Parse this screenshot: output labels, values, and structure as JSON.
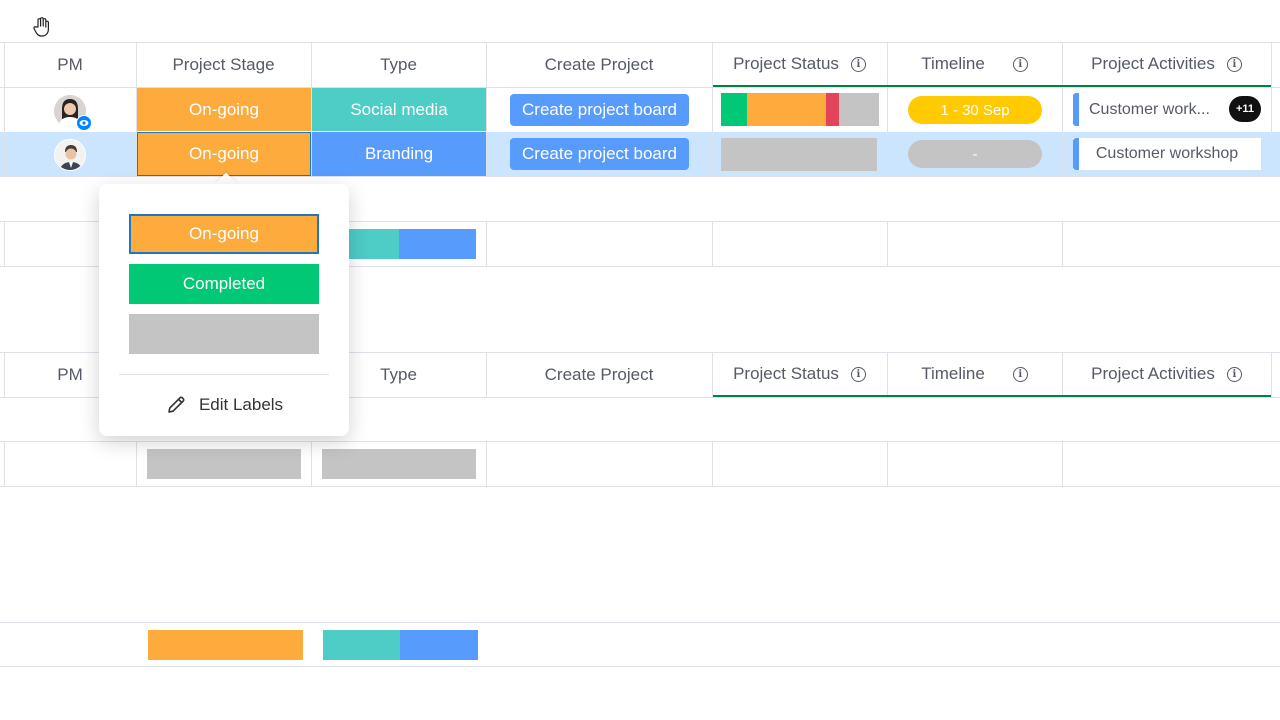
{
  "colors": {
    "on_going": "#fdab3d",
    "completed": "#00c875",
    "empty": "#c4c4c4",
    "social_media": "#4eccc6",
    "branding": "#579bfc",
    "stuck": "#e2445c",
    "timeline_yellow": "#ffcb00",
    "selected_row": "#cce5ff",
    "header_underline": "#037f4c"
  },
  "board1": {
    "headers": {
      "pm": "PM",
      "project_stage": "Project Stage",
      "type": "Type",
      "create_project": "Create Project",
      "project_status": "Project Status",
      "timeline": "Timeline",
      "project_activities": "Project Activities"
    },
    "rows": [
      {
        "stage": "On-going",
        "type": "Social media",
        "create_button": "Create project board",
        "status_bar": [
          {
            "label": "Completed",
            "fraction": 0.16
          },
          {
            "label": "On-going",
            "fraction": 0.5
          },
          {
            "label": "Stuck",
            "fraction": 0.08
          },
          {
            "label": "Empty",
            "fraction": 0.26
          }
        ],
        "timeline": "1 - 30 Sep",
        "activity": "Customer work...",
        "activity_count": "+11"
      },
      {
        "stage": "On-going",
        "type": "Branding",
        "create_button": "Create project board",
        "timeline": "-",
        "activity": "Customer workshop"
      }
    ]
  },
  "board2": {
    "headers": {
      "pm": "PM",
      "type": "Type",
      "create_project": "Create Project",
      "project_status": "Project Status",
      "timeline": "Timeline",
      "project_activities": "Project Activities"
    }
  },
  "label_picker": {
    "options": [
      "On-going",
      "Completed",
      ""
    ],
    "edit_labels": "Edit Labels"
  }
}
